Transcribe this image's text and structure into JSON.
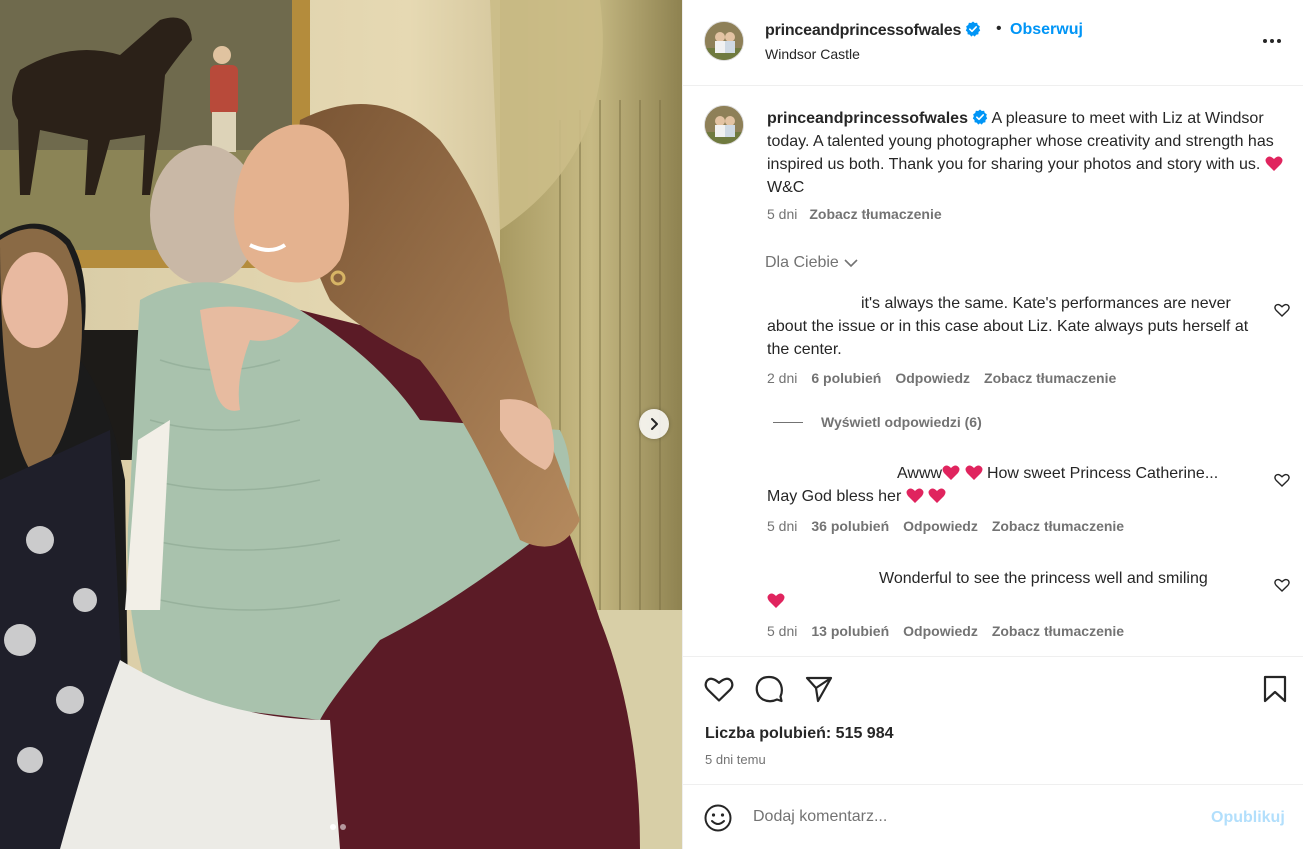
{
  "post": {
    "username": "princeandprincessofwales",
    "follow_label": "Obserwuj",
    "bullet": "•",
    "location": "Windsor Castle",
    "more_icon": "more-horizontal-icon"
  },
  "caption": {
    "username": "princeandprincessofwales",
    "text_1": "A pleasure to meet with Liz at Windsor today. A talented young photographer whose creativity and strength has inspired us both. Thank you for sharing your photos and story with us.",
    "text_2": "W&C",
    "time": "5 dni",
    "translate": "Zobacz tłumaczenie"
  },
  "filter": {
    "label": "Dla Ciebie"
  },
  "comments": [
    {
      "text": "it's always the same. Kate's performances are never about the issue or in this case about Liz. Kate always puts herself at the center.",
      "time": "2 dni",
      "likes": "6 polubień",
      "reply": "Odpowiedz",
      "translate": "Zobacz tłumaczenie",
      "view_replies": "Wyświetl odpowiedzi (6)"
    },
    {
      "text_1": "Awww",
      "text_2": "How sweet Princess Catherine...",
      "text_3": "May God bless her",
      "time": "5 dni",
      "likes": "36 polubień",
      "reply": "Odpowiedz",
      "translate": "Zobacz tłumaczenie"
    },
    {
      "text": "Wonderful to see the princess well and smiling",
      "time": "5 dni",
      "likes": "13 polubień",
      "reply": "Odpowiedz",
      "translate": "Zobacz tłumaczenie"
    }
  ],
  "actions": {
    "likes_label": "Liczba polubień: 515 984",
    "posted": "5 dni temu"
  },
  "add_comment": {
    "placeholder": "Dodaj komentarz...",
    "post_label": "Opublikuj"
  },
  "colors": {
    "link_blue": "#0095f6",
    "verified_blue": "#0095f6",
    "heart_red": "#e0245e",
    "muted": "#737373",
    "post_disabled": "#b2dffc"
  }
}
